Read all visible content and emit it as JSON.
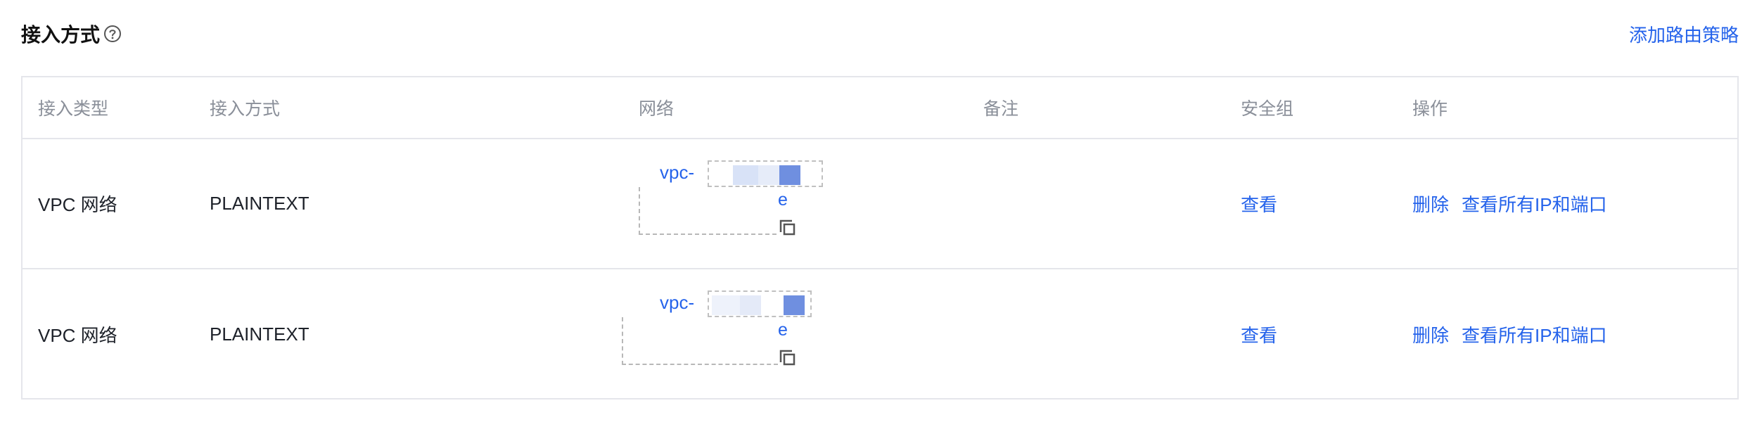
{
  "header": {
    "title": "接入方式",
    "add_route_link": "添加路由策略"
  },
  "table": {
    "columns": [
      "接入类型",
      "接入方式",
      "网络",
      "备注",
      "安全组",
      "操作"
    ],
    "rows": [
      {
        "access_type": "VPC 网络",
        "access_method": "PLAINTEXT",
        "network_prefix": "vpc-",
        "network_suffix": "e",
        "remark": "",
        "security_group": "查看",
        "op_delete": "删除",
        "op_view_all": "查看所有IP和端口"
      },
      {
        "access_type": "VPC 网络",
        "access_method": "PLAINTEXT",
        "network_prefix": "vpc-",
        "network_suffix": "e",
        "remark": "",
        "security_group": "查看",
        "op_delete": "删除",
        "op_view_all": "查看所有IP和端口"
      }
    ]
  },
  "icons": {
    "help": "question-circle-icon",
    "copy": "copy-icon"
  },
  "colors": {
    "accent": "#2563eb",
    "header_text": "#8a8f99",
    "border": "#e5e6eb"
  }
}
